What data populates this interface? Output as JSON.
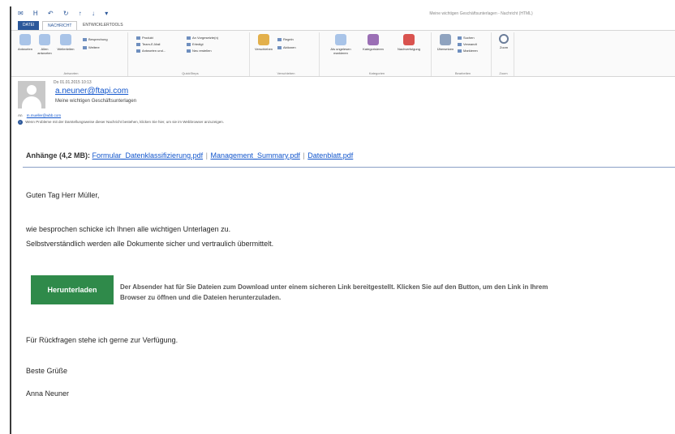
{
  "window": {
    "quick_access": "✉ H ↶ ↻ ↑ ↓ ▾",
    "title": "Meine wichtigen Geschäftsunterlagen - Nachricht (HTML)"
  },
  "tabs": [
    "DATEI",
    "NACHRICHT",
    "ENTWICKLERTOOLS"
  ],
  "ribbon": {
    "antworten": {
      "label": "Antworten",
      "buttons": [
        "Antworten",
        "Allen antworten",
        "Weiterleiten"
      ],
      "small": [
        "Besprechung",
        "Weitere"
      ]
    },
    "quicksteps": {
      "label": "QuickSteps",
      "items": [
        "Produkt",
        "Team-E-Mail",
        "Antworten und...",
        "An Vorgesetzte(n)",
        "Erledigt",
        "Neu erstellen"
      ]
    },
    "verschieben": {
      "label": "Verschieben",
      "buttons": [
        "Verschieben"
      ],
      "small": [
        "Regeln",
        "Aktionen"
      ]
    },
    "kategorien": {
      "label": "Kategorien",
      "buttons": [
        "Als ungelesen markieren",
        "Kategorisieren",
        "Nachverfolgung"
      ]
    },
    "bearbeiten": {
      "label": "Bearbeiten",
      "buttons": [
        "Übersetzen"
      ],
      "small": [
        "Suchen",
        "Verwandt",
        "Markieren"
      ]
    },
    "zoom": {
      "label": "Zoom",
      "buttons": [
        "Zoom"
      ]
    }
  },
  "header": {
    "date": "Do 01.01.2015 10:13",
    "sender": "a.neuner@ftapi.com",
    "subject": "Meine wichtigen Geschäftsunterlagen",
    "to_label": "An",
    "to": "m.mueller@wbb.com",
    "info": "Wenn Probleme mit der Darstellungsweise dieser Nachricht bestehen, klicken Sie hier, um sie im Webbrowser anzuzeigen."
  },
  "attachments": {
    "label": "Anhänge (4,2 MB):",
    "files": [
      "Formular_Datenklassifizierung.pdf",
      "Management_Summary.pdf",
      "Datenblatt.pdf"
    ],
    "separator": "|"
  },
  "body": {
    "greeting": "Guten Tag Herr Müller,",
    "line1": "wie besprochen schicke ich Ihnen alle wichtigen Unterlagen zu.",
    "line2": "Selbstverständlich werden alle Dokumente sicher und vertraulich übermittelt.",
    "button": "Herunterladen",
    "button_text": "Der Absender hat für Sie Dateien zum Download unter einem sicheren Link bereitgestellt. Klicken Sie auf den Button, um den Link in Ihrem Browser zu öffnen und die Dateien herunterzuladen.",
    "line3": "Für Rückfragen stehe ich gerne zur Verfügung.",
    "closing": "Beste Grüße",
    "signature": "Anna Neuner"
  },
  "colors": {
    "accent": "#2b579a",
    "link": "#1155cc",
    "button": "#2f8a4a"
  }
}
